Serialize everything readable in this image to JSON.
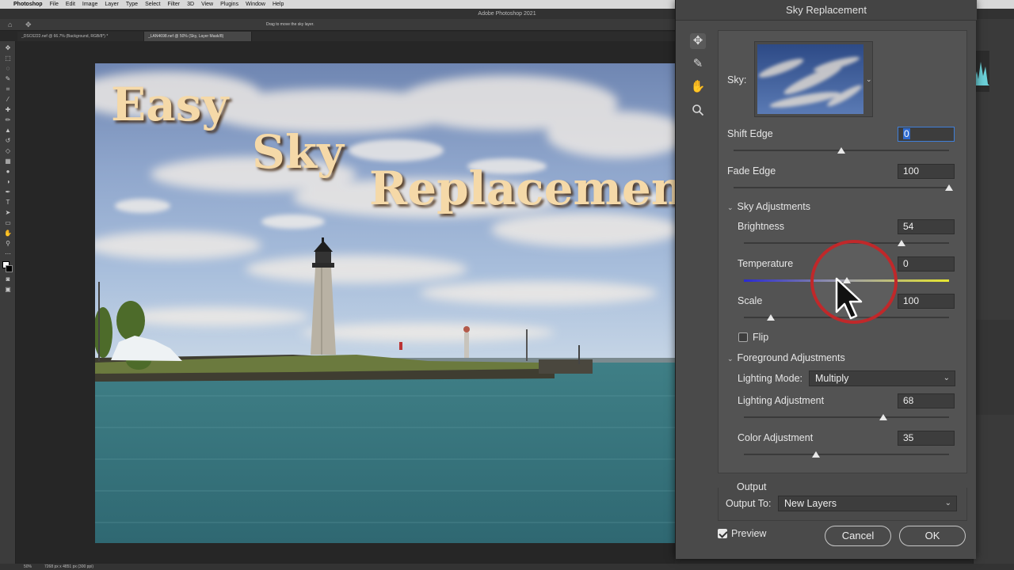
{
  "menubar": {
    "app": "Photoshop",
    "items": [
      "File",
      "Edit",
      "Image",
      "Layer",
      "Type",
      "Select",
      "Filter",
      "3D",
      "View",
      "Plugins",
      "Window",
      "Help"
    ]
  },
  "window_title": "Adobe Photoshop 2021",
  "options_bar": {
    "hint": "Drag to move the sky layer."
  },
  "tabs": [
    "_DSC6222.nef @ 66.7% (Background, RGB/8*) *",
    "_LAN4698.nef @ 50% (Sky, Layer Mask/8)"
  ],
  "canvas_text": {
    "line1": "Easy",
    "line2": "Sky",
    "line3": "Replacement"
  },
  "status": {
    "zoom": "50%",
    "doc": "7268 px x 4851 px (300 ppi)"
  },
  "dialog": {
    "title": "Sky Replacement",
    "sky_label": "Sky:",
    "shift_edge": {
      "label": "Shift Edge",
      "value": "0",
      "level": 0.5
    },
    "fade_edge": {
      "label": "Fade Edge",
      "value": "100",
      "level": 1.0
    },
    "sky_adjustments": {
      "label": "Sky Adjustments"
    },
    "brightness": {
      "label": "Brightness",
      "value": "54",
      "level": 0.77
    },
    "temperature": {
      "label": "Temperature",
      "value": "0",
      "level": 0.5
    },
    "scale": {
      "label": "Scale",
      "value": "100",
      "level": 0.13
    },
    "flip": {
      "label": "Flip",
      "checked": false
    },
    "foreground_adjustments": {
      "label": "Foreground Adjustments"
    },
    "lighting_mode": {
      "label": "Lighting Mode:",
      "value": "Multiply"
    },
    "lighting_adjustment": {
      "label": "Lighting Adjustment",
      "value": "68",
      "level": 0.68
    },
    "color_adjustment": {
      "label": "Color Adjustment",
      "value": "35",
      "level": 0.35
    },
    "output": {
      "label": "Output",
      "output_to_label": "Output To:",
      "output_to_value": "New Layers"
    },
    "preview": {
      "label": "Preview",
      "checked": true
    },
    "cancel_label": "Cancel",
    "ok_label": "OK"
  },
  "colors": {
    "temperature_cold": "#2a2ad0",
    "temperature_warm": "#e8e830",
    "highlight_ring": "#c0282a",
    "title_text": "#f5d9a8"
  },
  "icons": [
    "move-icon",
    "brush-icon",
    "hand-icon",
    "zoom-icon",
    "apple-icon",
    "home-icon",
    "chevron-down-icon",
    "cursor-icon"
  ]
}
